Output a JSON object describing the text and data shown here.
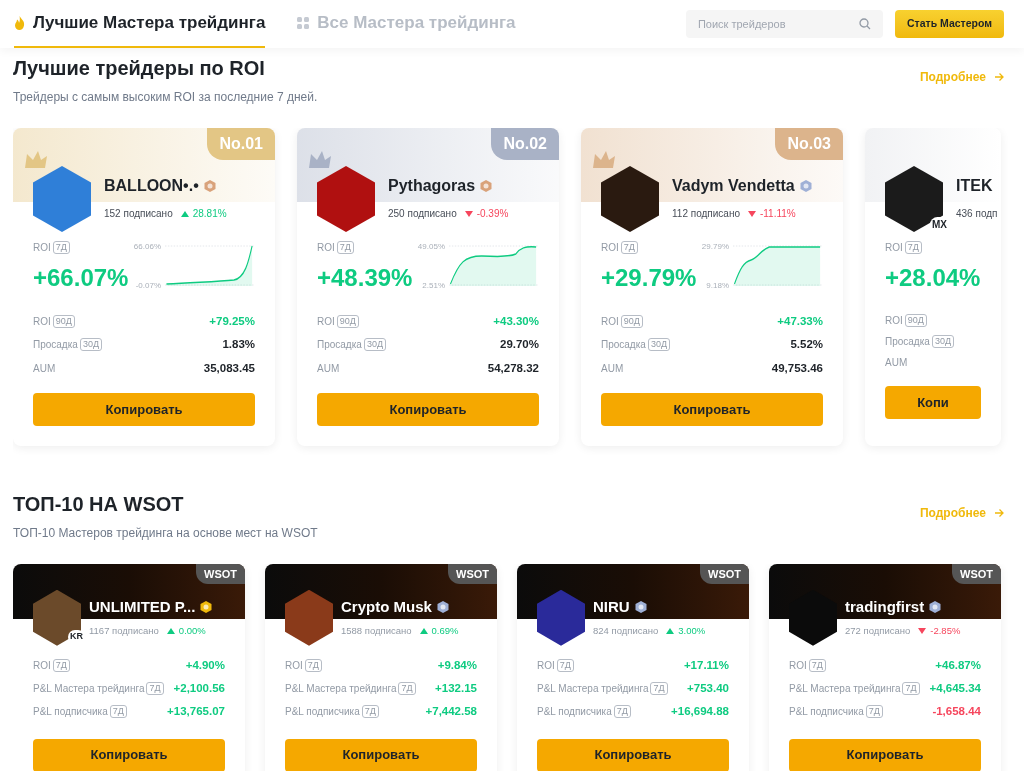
{
  "top_nav": {
    "tabs": [
      {
        "label": "Лучшие Мастера трейдинга",
        "selected": true
      },
      {
        "label": "Все Мастера трейдинга",
        "selected": false
      }
    ],
    "search": {
      "placeholder": "Поиск трейдеров"
    },
    "primary_button": "Стать Мастером"
  },
  "roi_section": {
    "title": "Лучшие трейдеры по ROI",
    "subtitle": "Трейдеры с самым высоким ROI за последние 7 дней.",
    "more_link": "Подробнее",
    "cards": [
      {
        "color": "#e3c685",
        "rank": "No.01",
        "name": "BALLOON•.•",
        "subscribers": "152 подписано",
        "change": "28.81%",
        "roi_label": "ROI",
        "roi_period": "7Д",
        "roi_value": "+66.07%",
        "chart_max": "66.06%",
        "chart_min": "-0.07%",
        "stats": [
          {
            "label": "ROI",
            "period": "90Д",
            "value": "+79.25%",
            "color": "#0ecb81"
          },
          {
            "label": "Просадка",
            "period": "30Д",
            "value": "1.83%",
            "color": "#1e2329"
          },
          {
            "label": "AUM",
            "value": "35,083.45",
            "color": "#1e2329"
          }
        ],
        "button": "Копировать"
      },
      {
        "color": "#a9b2c6",
        "rank": "No.02",
        "name": "Pythagoras",
        "subscribers": "250 подписано",
        "change": "-0.39%",
        "roi_label": "ROI",
        "roi_period": "7Д",
        "roi_value": "+48.39%",
        "chart_max": "49.05%",
        "chart_min": "2.51%",
        "stats": [
          {
            "label": "ROI",
            "period": "90Д",
            "value": "+43.30%",
            "color": "#0ecb81"
          },
          {
            "label": "Просадка",
            "period": "30Д",
            "value": "29.70%",
            "color": "#1e2329"
          },
          {
            "label": "AUM",
            "value": "54,278.32",
            "color": "#1e2329"
          }
        ],
        "button": "Копировать"
      },
      {
        "color": "#dcb48c",
        "rank": "No.03",
        "name": "Vadym Vendetta",
        "subscribers": "112 подписано",
        "change": "-11.11%",
        "roi_label": "ROI",
        "roi_period": "7Д",
        "roi_value": "+29.79%",
        "chart_max": "29.79%",
        "chart_min": "9.18%",
        "stats": [
          {
            "label": "ROI",
            "period": "90Д",
            "value": "+47.33%",
            "color": "#0ecb81"
          },
          {
            "label": "Просадка",
            "period": "30Д",
            "value": "5.52%",
            "color": "#1e2329"
          },
          {
            "label": "AUM",
            "value": "49,753.46",
            "color": "#1e2329"
          }
        ],
        "button": "Копировать"
      },
      {
        "name": "ITEK",
        "avatar_tag": "MX",
        "subscribers": "436 подп",
        "roi_label": "ROI",
        "roi_period": "7Д",
        "roi_value": "+28.04%",
        "stats": [
          {
            "label": "ROI",
            "period": "90Д"
          },
          {
            "label": "Просадка",
            "period": "30Д"
          },
          {
            "label": "AUM"
          }
        ],
        "button": "Копи"
      }
    ]
  },
  "wsot_section": {
    "title": "ТОП-10 НА WSOT",
    "subtitle": "ТОП-10 Мастеров трейдинга на основе мест на WSOT",
    "more_link": "Подробнее",
    "cards": [
      {
        "tag": "WSOT",
        "name": "UNLIMITED P...",
        "avatar_tag": "KR",
        "subscribers": "1167 подписано",
        "change": "0.00%",
        "stats": [
          {
            "label": "ROI",
            "period": "7Д",
            "value": "+4.90%",
            "color": "#0ecb81"
          },
          {
            "label": "P&L Мастера трейдинга",
            "period": "7Д",
            "value": "+2,100.56",
            "color": "#0ecb81"
          },
          {
            "label": "P&L подписчика",
            "period": "7Д",
            "value": "+13,765.07",
            "color": "#0ecb81"
          }
        ],
        "button": "Копировать"
      },
      {
        "tag": "WSOT",
        "name": "Crypto Musk",
        "subscribers": "1588 подписано",
        "change": "0.69%",
        "stats": [
          {
            "label": "ROI",
            "period": "7Д",
            "value": "+9.84%",
            "color": "#0ecb81"
          },
          {
            "label": "P&L Мастера трейдинга",
            "period": "7Д",
            "value": "+132.15",
            "color": "#0ecb81"
          },
          {
            "label": "P&L подписчика",
            "period": "7Д",
            "value": "+7,442.58",
            "color": "#0ecb81"
          }
        ],
        "button": "Копировать"
      },
      {
        "tag": "WSOT",
        "name": "NIRU",
        "subscribers": "824 подписано",
        "change": "3.00%",
        "stats": [
          {
            "label": "ROI",
            "period": "7Д",
            "value": "+17.11%",
            "color": "#0ecb81"
          },
          {
            "label": "P&L Мастера трейдинга",
            "period": "7Д",
            "value": "+753.40",
            "color": "#0ecb81"
          },
          {
            "label": "P&L подписчика",
            "period": "7Д",
            "value": "+16,694.88",
            "color": "#0ecb81"
          }
        ],
        "button": "Копировать"
      },
      {
        "tag": "WSOT",
        "name": "tradingfirst",
        "subscribers": "272 подписано",
        "change": "-2.85%",
        "stats": [
          {
            "label": "ROI",
            "period": "7Д",
            "value": "+46.87%",
            "color": "#0ecb81"
          },
          {
            "label": "P&L Мастера трейдинга",
            "period": "7Д",
            "value": "+4,645.34",
            "color": "#0ecb81"
          },
          {
            "label": "P&L подписчика",
            "period": "7Д",
            "value": "-1,658.44",
            "color": "#f6465d"
          }
        ],
        "button": "Копировать"
      }
    ]
  }
}
